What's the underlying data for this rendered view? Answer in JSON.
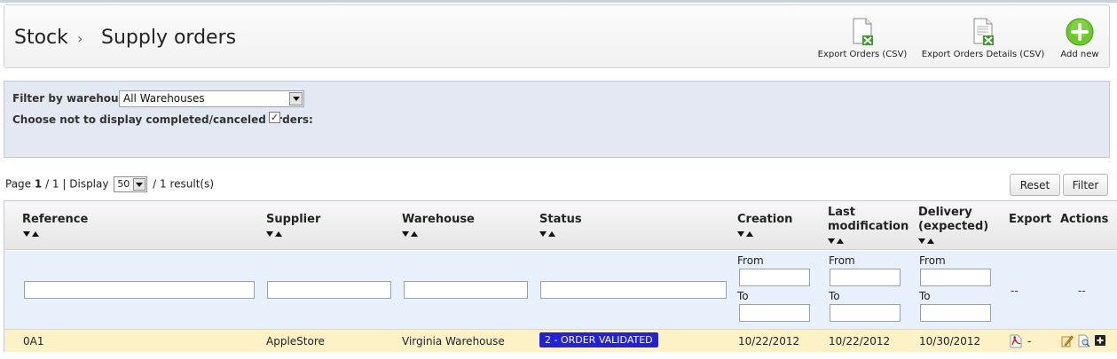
{
  "breadcrumb": {
    "section": "Stock",
    "separator": "›",
    "page": "Supply orders"
  },
  "toolbar": {
    "export_orders": "Export Orders (CSV)",
    "export_details": "Export Orders Details (CSV)",
    "add_new": "Add new"
  },
  "filters": {
    "warehouse_label": "Filter by warehouse:",
    "warehouse_value": "All Warehouses",
    "hide_completed_label": "Choose not to display completed/canceled orders:",
    "hide_completed_checked": "✓"
  },
  "pagination": {
    "page_prefix": "Page",
    "page_current": "1",
    "page_total": "/ 1 | Display",
    "per_page": "50",
    "results": "/ 1 result(s)"
  },
  "buttons": {
    "reset": "Reset",
    "filter": "Filter"
  },
  "table": {
    "headers": {
      "reference": "Reference",
      "supplier": "Supplier",
      "warehouse": "Warehouse",
      "status": "Status",
      "creation": "Creation",
      "last_mod_1": "Last",
      "last_mod_2": "modification",
      "delivery_1": "Delivery",
      "delivery_2": "(expected)",
      "export": "Export",
      "actions": "Actions"
    },
    "filter_labels": {
      "from": "From",
      "to": "To",
      "empty": "--"
    },
    "rows": [
      {
        "reference": "0A1",
        "supplier": "AppleStore",
        "warehouse": "Virginia Warehouse",
        "status": "2 - ORDER VALIDATED",
        "creation": "10/22/2012",
        "last_modification": "10/22/2012",
        "delivery": "10/30/2012",
        "export_suffix": "-"
      }
    ]
  },
  "colors": {
    "status_badge": "#2222dd",
    "row_highlight": "#fdf2c6",
    "filter_panel": "#e3e8f2",
    "add_icon": "#6cc92a"
  }
}
